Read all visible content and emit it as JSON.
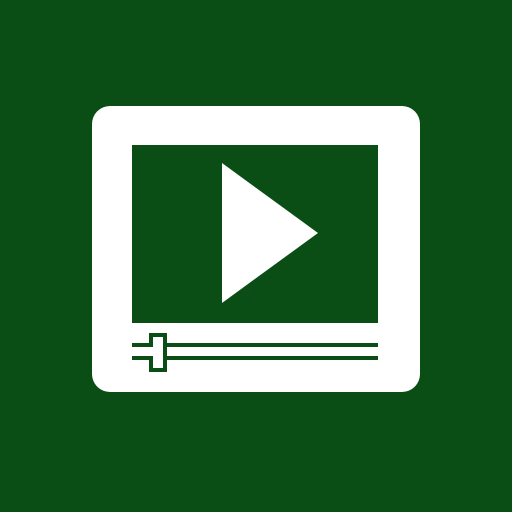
{
  "app": {
    "icon": "video-player-icon",
    "colors": {
      "background": "#0a4d15",
      "foreground": "#ffffff"
    }
  },
  "player": {
    "progress_fraction": 0.1
  }
}
